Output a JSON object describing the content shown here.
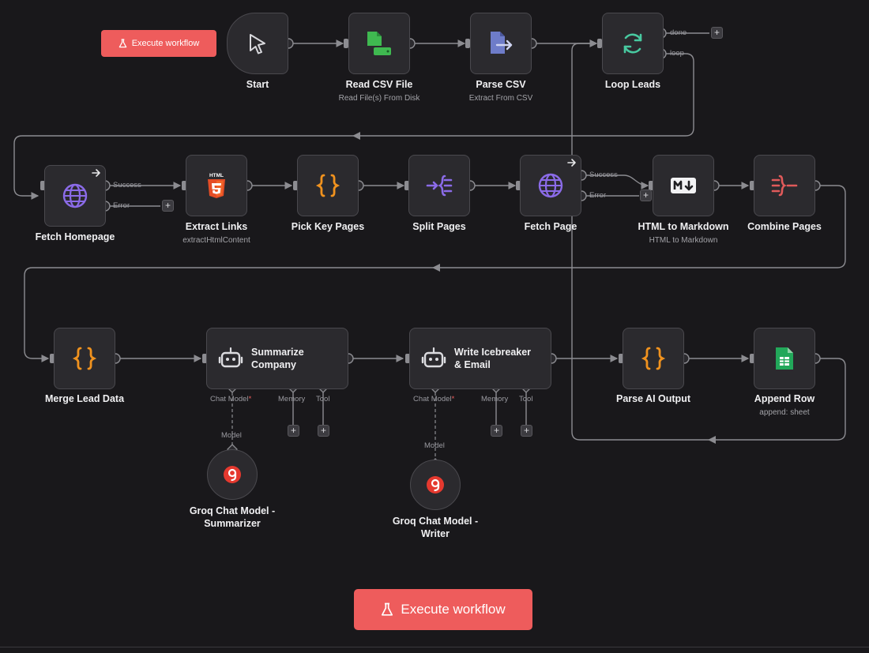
{
  "toolbar": {
    "execute_small_label": "Execute workflow"
  },
  "footer": {
    "execute_label": "Execute workflow"
  },
  "nodes": {
    "start": {
      "title": "Start"
    },
    "read_csv": {
      "title": "Read CSV File",
      "subtitle": "Read File(s) From Disk"
    },
    "parse_csv": {
      "title": "Parse CSV",
      "subtitle": "Extract From CSV"
    },
    "loop_leads": {
      "title": "Loop Leads",
      "output_done": "done",
      "output_loop": "loop"
    },
    "fetch_homepage": {
      "title": "Fetch Homepage",
      "output_success": "Success",
      "output_error": "Error"
    },
    "extract_links": {
      "title": "Extract Links",
      "subtitle": "extractHtmlContent",
      "badge": "HTML"
    },
    "pick_key_pages": {
      "title": "Pick Key Pages"
    },
    "split_pages": {
      "title": "Split Pages"
    },
    "fetch_page": {
      "title": "Fetch Page",
      "output_success": "Success",
      "output_error": "Error"
    },
    "html_to_markdown": {
      "title": "HTML to Markdown",
      "subtitle": "HTML to Markdown"
    },
    "combine_pages": {
      "title": "Combine Pages"
    },
    "merge_lead_data": {
      "title": "Merge Lead Data"
    },
    "summarize_company": {
      "title": "Summarize\nCompany",
      "input_chat_model": "Chat Model",
      "input_memory": "Memory",
      "input_tool": "Tool"
    },
    "write_icebreaker": {
      "title": "Write Icebreaker\n& Email",
      "input_chat_model": "Chat Model",
      "input_memory": "Memory",
      "input_tool": "Tool"
    },
    "parse_ai_output": {
      "title": "Parse AI Output"
    },
    "append_row": {
      "title": "Append Row",
      "subtitle": "append: sheet"
    },
    "groq_summarizer": {
      "title": "Groq Chat Model -\nSummarizer",
      "output_model": "Model"
    },
    "groq_writer": {
      "title": "Groq Chat Model -\nWriter",
      "output_model": "Model"
    }
  },
  "colors": {
    "background": "#19181b",
    "node_fill": "#2b2a2e",
    "node_border": "#4a494e",
    "connector": "#8c8c91",
    "accent_red": "#ee5c5c",
    "icon_green": "#3fb950",
    "icon_indigo": "#6e7cc9",
    "icon_teal": "#48c9a0",
    "icon_violet": "#8b6be8",
    "icon_orange": "#f0921e",
    "icon_html": "#e44d26",
    "icon_combine": "#e05a5a",
    "sheets_green": "#22a85a"
  }
}
